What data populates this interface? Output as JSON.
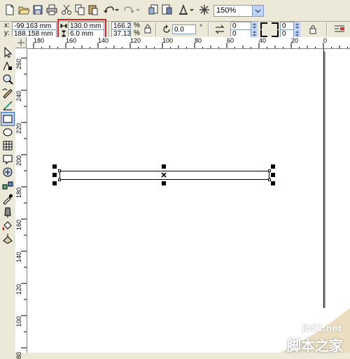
{
  "toolbar": {
    "zoom_value": "150%"
  },
  "propertybar": {
    "x_label": "x:",
    "x_value": "-99.163 mm",
    "y_label": "y:",
    "y_value": "188.158 mm",
    "width_value": "130.0 mm",
    "height_value": "6.0 mm",
    "scale_x_value": "166.2",
    "scale_y_value": "37.13",
    "percent_symbol": "%",
    "rotation_value": "0.0",
    "degree_symbol": "°",
    "corner_tl_value": "0",
    "corner_bl_value": "0",
    "corner_tr_value": "0",
    "corner_br_value": "0"
  },
  "ruler_top": {
    "labels": [
      "180",
      "160",
      "140",
      "120",
      "100",
      "80",
      "60",
      "40",
      "20",
      "0"
    ]
  },
  "ruler_left": {
    "labels": [
      "260",
      "240",
      "220",
      "200",
      "180",
      "160",
      "140",
      "120",
      "100",
      "80"
    ]
  },
  "highlight": {
    "color": "#e02020"
  },
  "watermark": {
    "site": "jb51.net",
    "text": "脚本之家"
  }
}
